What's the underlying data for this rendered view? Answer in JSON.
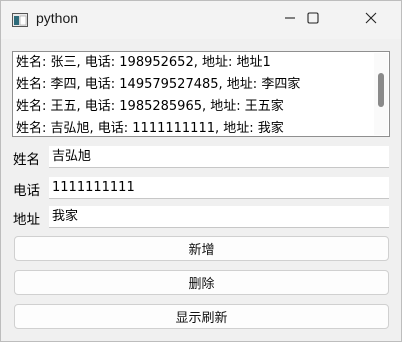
{
  "window": {
    "title": "python",
    "controls": {
      "minimize_icon": "minimize-icon",
      "maximize_icon": "maximize-icon",
      "close_icon": "close-icon"
    }
  },
  "list": {
    "items": [
      "姓名: 张三, 电话: 198952652, 地址: 地址1",
      "姓名: 李四, 电话: 149579527485, 地址: 李四家",
      "姓名: 王五, 电话: 1985285965, 地址: 王五家",
      "姓名: 吉弘旭, 电话: 1111111111, 地址: 我家"
    ]
  },
  "form": {
    "name_label": "姓名",
    "name_value": "吉弘旭",
    "phone_label": "电话",
    "phone_value": "1111111111",
    "address_label": "地址",
    "address_value": "我家"
  },
  "buttons": {
    "add": "新增",
    "delete": "删除",
    "refresh": "显示刷新"
  }
}
